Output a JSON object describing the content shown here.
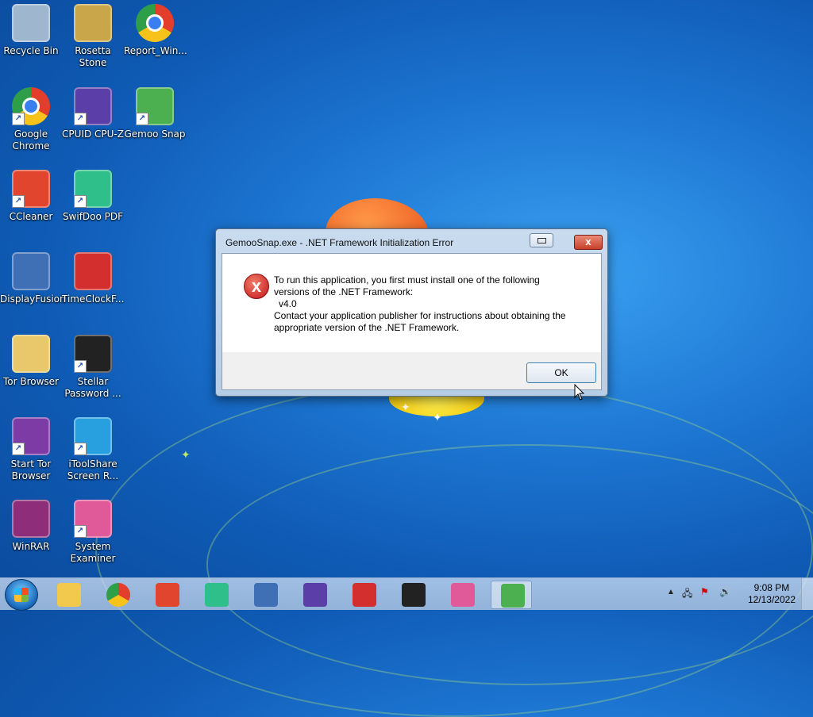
{
  "desktop": {
    "icons": [
      {
        "label": "Recycle Bin",
        "name": "recycle-bin-icon",
        "color": "#9fb6cf"
      },
      {
        "label": "Rosetta Stone",
        "name": "rosetta-stone-icon",
        "color": "#c9a64a"
      },
      {
        "label": "Report_Win...",
        "name": "chrome-icon",
        "color": "#e33e2b"
      },
      {
        "label": "Google Chrome",
        "name": "chrome-icon",
        "color": "#e33e2b"
      },
      {
        "label": "CPUID CPU-Z",
        "name": "cpu-z-icon",
        "color": "#5c3ea8"
      },
      {
        "label": "Gemoo Snap",
        "name": "gemoo-snap-icon",
        "color": "#4caf50"
      },
      {
        "label": "CCleaner",
        "name": "ccleaner-icon",
        "color": "#e2452d"
      },
      {
        "label": "SwifDoo PDF",
        "name": "swifdoo-pdf-icon",
        "color": "#2ebf8a"
      },
      {
        "label": "DisplayFusion",
        "name": "displayfusion-icon",
        "color": "#3f6fb5"
      },
      {
        "label": "TimeClockF...",
        "name": "timeclock-icon",
        "color": "#d32f2f"
      },
      {
        "label": "Tor Browser",
        "name": "tor-folder-icon",
        "color": "#e8c86a"
      },
      {
        "label": "Stellar Password ...",
        "name": "stellar-password-icon",
        "color": "#222222"
      },
      {
        "label": "Start Tor Browser",
        "name": "tor-browser-icon",
        "color": "#7d3ba6"
      },
      {
        "label": "iToolShare Screen R...",
        "name": "itoolshare-icon",
        "color": "#28a0e0"
      },
      {
        "label": "WinRAR",
        "name": "winrar-icon",
        "color": "#8e2d7a"
      },
      {
        "label": "System Examiner",
        "name": "system-examiner-icon",
        "color": "#e05a9a"
      }
    ]
  },
  "dialog": {
    "title": "GemooSnap.exe - .NET Framework Initialization Error",
    "close_glyph": "x",
    "error_glyph": "x",
    "message_lines": [
      "To run this application, you first must install one of the following",
      "versions of the .NET Framework:",
      "  v4.0",
      "Contact your application publisher for instructions about obtaining the",
      "appropriate version of the .NET Framework."
    ],
    "ok_label": "OK"
  },
  "taskbar": {
    "apps": [
      {
        "name": "explorer-icon",
        "color": "#f2c94c"
      },
      {
        "name": "chrome-icon",
        "color": "#e33e2b"
      },
      {
        "name": "ccleaner-icon",
        "color": "#e2452d"
      },
      {
        "name": "swifdoo-pdf-icon",
        "color": "#2ebf8a"
      },
      {
        "name": "displayfusion-icon",
        "color": "#3f6fb5"
      },
      {
        "name": "cpu-z-icon",
        "color": "#5c3ea8"
      },
      {
        "name": "timeclock-icon",
        "color": "#d32f2f"
      },
      {
        "name": "stellar-password-icon",
        "color": "#222222"
      },
      {
        "name": "system-examiner-icon",
        "color": "#e05a9a"
      },
      {
        "name": "gemoo-snap-icon",
        "color": "#4caf50"
      }
    ],
    "time": "9:08 PM",
    "date": "12/13/2022"
  }
}
